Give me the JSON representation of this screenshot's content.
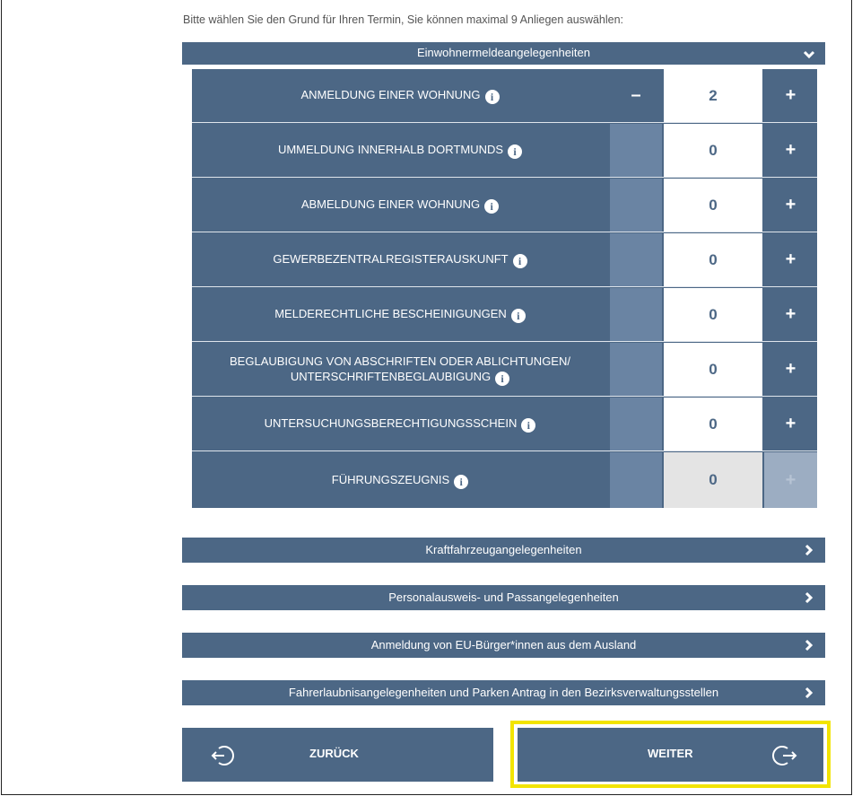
{
  "intro_text": "Bitte wählen Sie den Grund für Ihren Termin, Sie können maximal 9 Anliegen auswählen:",
  "open_section": {
    "title": "Einwohnermeldeangelegenheiten",
    "items": [
      {
        "label": "ANMELDUNG EINER WOHNUNG",
        "count": "2"
      },
      {
        "label": "UMMELDUNG INNERHALB DORTMUNDS",
        "count": "0"
      },
      {
        "label": "ABMELDUNG EINER WOHNUNG",
        "count": "0"
      },
      {
        "label": "GEWERBEZENTRALREGISTERAUSKUNFT",
        "count": "0"
      },
      {
        "label": "MELDERECHTLICHE BESCHEINIGUNGEN",
        "count": "0"
      },
      {
        "label_line1": "BEGLAUBIGUNG VON ABSCHRIFTEN ODER ABLICHTUNGEN/",
        "label_line2": "UNTERSCHRIFTENBEGLAUBIGUNG",
        "count": "0"
      },
      {
        "label": "UNTERSUCHUNGSBERECHTIGUNGSSCHEIN",
        "count": "0"
      },
      {
        "label": "FÜHRUNGSZEUGNIS",
        "count": "0"
      }
    ],
    "minus_symbol": "–",
    "plus_symbol": "+",
    "info_symbol": "i"
  },
  "sections": [
    {
      "title": "Kraftfahrzeugangelegenheiten"
    },
    {
      "title": "Personalausweis- und Passangelegenheiten"
    },
    {
      "title": "Anmeldung von EU-Bürger*innen aus dem Ausland"
    },
    {
      "title": "Fahrerlaubnisangelegenheiten und Parken Antrag in den Bezirksverwaltungsstellen"
    }
  ],
  "nav": {
    "back_label": "ZURÜCK",
    "next_label": "WEITER"
  },
  "colors": {
    "primary": "#4c6785",
    "highlight": "#f2e400"
  }
}
